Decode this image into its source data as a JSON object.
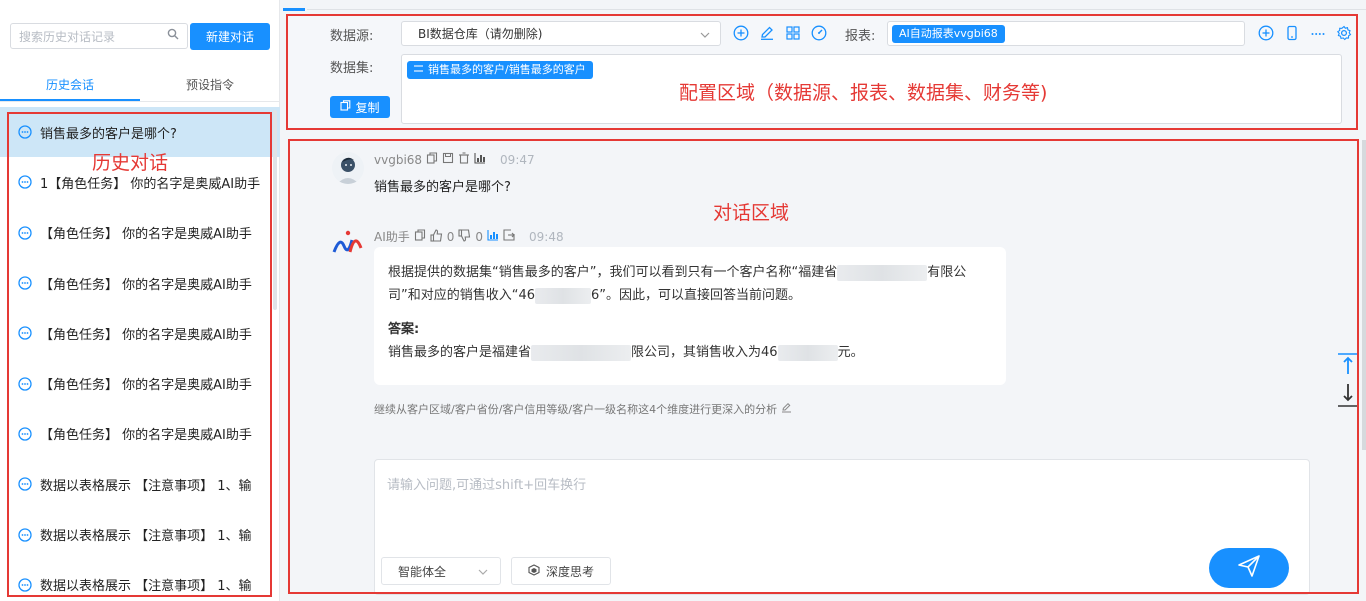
{
  "sidebar": {
    "search_placeholder": "搜索历史对话记录",
    "new_chat_label": "新建对话",
    "tabs": [
      {
        "label": "历史会话"
      },
      {
        "label": "预设指令"
      }
    ],
    "history": [
      {
        "label": "销售最多的客户是哪个?"
      },
      {
        "label": "1【角色任务】 你的名字是奥威AI助手"
      },
      {
        "label": "【角色任务】 你的名字是奥威AI助手"
      },
      {
        "label": "【角色任务】 你的名字是奥威AI助手"
      },
      {
        "label": "【角色任务】 你的名字是奥威AI助手"
      },
      {
        "label": "【角色任务】 你的名字是奥威AI助手"
      },
      {
        "label": "【角色任务】 你的名字是奥威AI助手"
      },
      {
        "label": "数据以表格展示 【注意事项】 1、输"
      },
      {
        "label": "数据以表格展示 【注意事项】 1、输"
      },
      {
        "label": "数据以表格展示 【注意事项】 1、输"
      }
    ]
  },
  "config": {
    "datasource_label": "数据源:",
    "datasource_value": "BI数据仓库（请勿删除)",
    "report_label": "报表:",
    "report_tag": "AI自动报表vvgbi68",
    "dataset_label": "数据集:",
    "dataset_tag": "销售最多的客户/销售最多的客户",
    "copy_label": "复制"
  },
  "chat": {
    "user_name": "vvgbi68",
    "user_time": "09:47",
    "user_message": "销售最多的客户是哪个?",
    "ai_name": "AI助手",
    "ai_like_count": "0",
    "ai_dislike_count": "0",
    "ai_time": "09:48",
    "ai_para1_a": "根据提供的数据集“销售最多的客户”，我们可以看到只有一个客户名称“福建省",
    "ai_para1_b": "有限公司”和对应的销售收入“46",
    "ai_para1_c": "6”。因此，可以直接回答当前问题。",
    "ai_answer_label": "答案:",
    "ai_answer_a": "销售最多的客户是福建省",
    "ai_answer_b": "限公司，其销售收入为46",
    "ai_answer_c": "元。",
    "followup": "继续从客户区域/客户省份/客户信用等级/客户一级名称这4个维度进行更深入的分析",
    "input_placeholder": "请输入问题,可通过shift+回车换行",
    "mode_value": "智能体全",
    "deep_think_label": "深度思考"
  },
  "annotations": {
    "history_area": "历史对话",
    "config_area": "配置区域（数据源、报表、数据集、财务等)",
    "chat_area": "对话区域"
  },
  "colors": {
    "accent": "#1890ff",
    "annotation": "#e53935",
    "history_active": "#cde6f7"
  }
}
